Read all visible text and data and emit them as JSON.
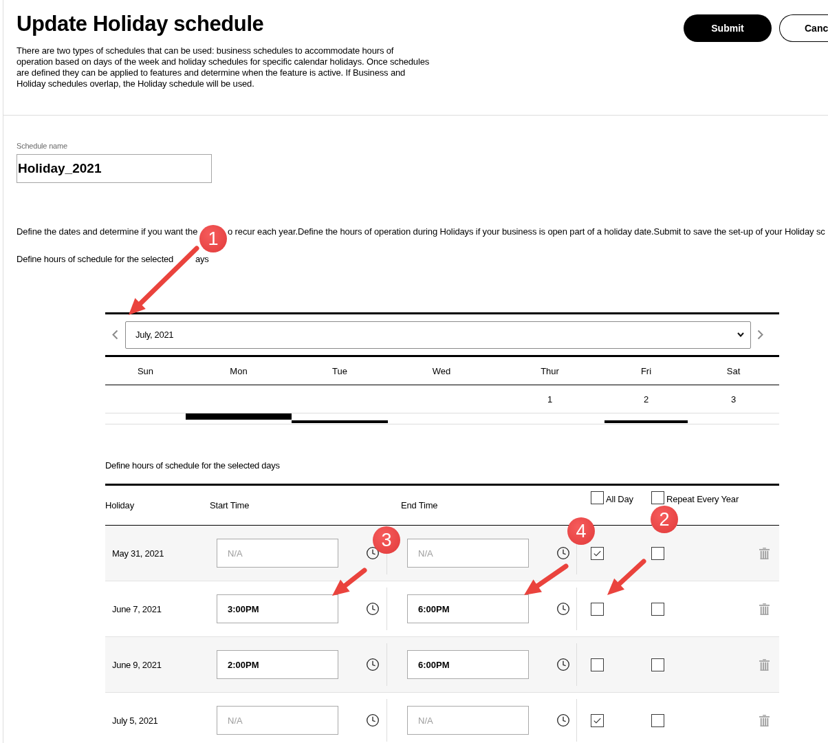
{
  "header": {
    "title": "Update Holiday schedule",
    "description_lines": [
      "There are two types of schedules that can be used: business schedules to accommodate hours of",
      "operation based on days of the week and holiday schedules for specific calendar holidays. Once schedules",
      "are defined they can be applied to features and determine when the feature is active. If Business and",
      "Holiday schedules overlap, the Holiday schedule will be used."
    ],
    "buttons": [
      {
        "label": "Submit",
        "kind": "primary"
      },
      {
        "label": "Canc",
        "kind": "outline"
      }
    ]
  },
  "schedule_name": {
    "label": "Schedule name",
    "value": "Holiday_2021"
  },
  "dates_note": {
    "parts": [
      "Define the dates and determine if you want the",
      "o recur each year.Define the hours of operation during Holidays if your business is open part of a holiday date.Submit to save the set-up of your Holiday sc"
    ]
  },
  "hours_note": {
    "parts": [
      "Define hours of schedule for the selected",
      "ays"
    ]
  },
  "calendar": {
    "month": "July, 2021",
    "weekdays": [
      {
        "label": "Sun",
        "kind": "plain"
      },
      {
        "label": "Mon",
        "kind": "thick"
      },
      {
        "label": "Tue",
        "kind": "thin"
      },
      {
        "label": "Wed",
        "kind": "plain"
      },
      {
        "label": "Thur",
        "date": "1",
        "kind": "plain"
      },
      {
        "label": "Fri",
        "date": "2",
        "kind": "thin"
      },
      {
        "label": "Sat",
        "date": "3",
        "kind": "plain"
      }
    ]
  },
  "schedule": {
    "title": "Define hours of schedule for the selected days",
    "columns": [
      {
        "label": "Holiday",
        "kind": "text"
      },
      {
        "label": "Start Time",
        "kind": "text"
      },
      {
        "label": "End Time",
        "kind": "text"
      },
      {
        "label": "All Day",
        "kind": "checkbox",
        "checked": false
      },
      {
        "label": "Repeat Every Year",
        "kind": "checkbox",
        "checked": false
      }
    ],
    "rows": [
      {
        "date": "May 31, 2021",
        "start": {
          "placeholder": "N/A"
        },
        "end": {
          "placeholder": "N/A"
        },
        "all_day": true,
        "repeat_every_year": false
      },
      {
        "date": "June 7, 2021",
        "start": {
          "value": "3:00PM"
        },
        "end": {
          "value": "6:00PM"
        },
        "all_day": false,
        "repeat_every_year": false
      },
      {
        "date": "June 9, 2021",
        "start": {
          "value": "2:00PM"
        },
        "end": {
          "value": "6:00PM"
        },
        "all_day": false,
        "repeat_every_year": false
      },
      {
        "date": "July 5, 2021",
        "start": {
          "placeholder": "N/A"
        },
        "end": {
          "placeholder": "N/A"
        },
        "all_day": true,
        "repeat_every_year": false
      }
    ]
  },
  "callouts": [
    {
      "number": "1"
    },
    {
      "number": "2"
    },
    {
      "number": "3"
    },
    {
      "number": "4"
    }
  ]
}
